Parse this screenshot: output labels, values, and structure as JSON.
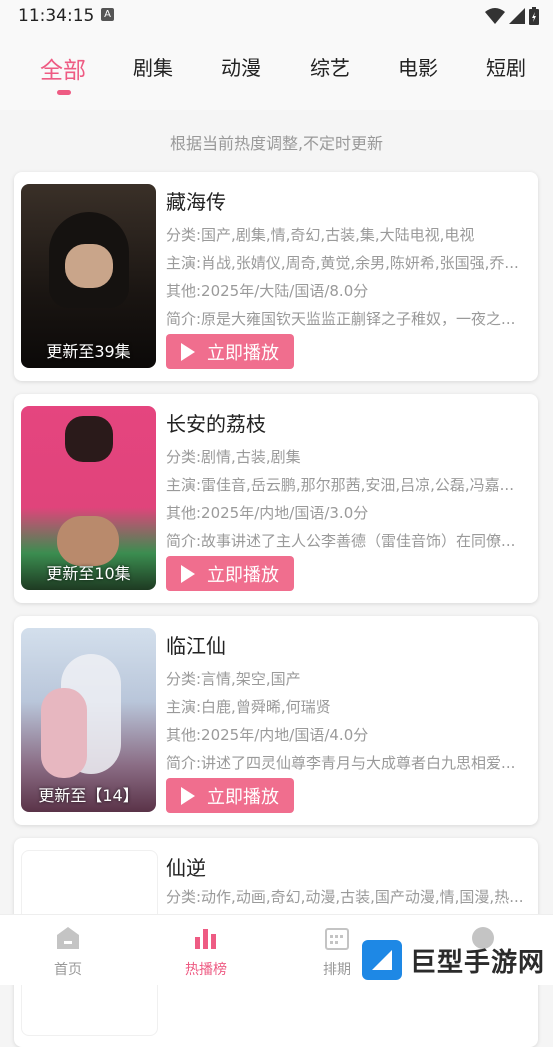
{
  "status": {
    "time": "11:34:15",
    "indicator": "A"
  },
  "tabs": [
    {
      "label": "全部"
    },
    {
      "label": "剧集"
    },
    {
      "label": "动漫"
    },
    {
      "label": "综艺"
    },
    {
      "label": "电影"
    },
    {
      "label": "短剧"
    }
  ],
  "notice": "根据当前热度调整,不定时更新",
  "play_label": "立即播放",
  "items": [
    {
      "title": "藏海传",
      "category": "分类:国产,剧集,情,奇幻,古装,集,大陆电视,电视",
      "cast": "主演:肖战,张婧仪,周奇,黄觉,余男,陈妍希,张国强,乔...",
      "other": "其他:2025年/大陆/国语/8.0分",
      "intro": "简介:原是大雍国钦天监监正蒯铎之子稚奴，一夜之...",
      "badge": "更新至39集",
      "colors": {
        "top": "#2c2620",
        "bottom": "#0d0b0a"
      }
    },
    {
      "title": "长安的荔枝",
      "category": "分类:剧情,古装,剧集",
      "cast": "主演:雷佳音,岳云鹏,那尔那茜,安沺,吕凉,公磊,冯嘉...",
      "other": "其他:2025年/内地/国语/3.0分",
      "intro": "简介:故事讲述了主人公李善德（雷佳音饰）在同僚...",
      "badge": "更新至10集",
      "colors": {
        "top": "#e0447b",
        "bottom": "#3a8a4e"
      }
    },
    {
      "title": "临江仙",
      "category": "分类:言情,架空,国产",
      "cast": "主演:白鹿,曾舜晞,何瑞贤",
      "other": "其他:2025年/内地/国语/4.0分",
      "intro": "简介:讲述了四灵仙尊李青月与大成尊者白九思相爱...",
      "badge": "更新至【14】",
      "colors": {
        "top": "#c6d4e4",
        "bottom": "#7a4a64"
      }
    },
    {
      "title": "仙逆",
      "category": "分类:动作,动画,奇幻,动漫,古装,国产动漫,情,国漫,热...",
      "cast": "",
      "other": "",
      "intro": "",
      "badge": "",
      "colors": {
        "top": "#ffffff",
        "bottom": "#ffffff"
      }
    }
  ],
  "bottom_nav": [
    {
      "label": "首页",
      "icon": "home-icon"
    },
    {
      "label": "热播榜",
      "icon": "bar-chart-icon"
    },
    {
      "label": "排期",
      "icon": "calendar-icon"
    },
    {
      "label": "",
      "icon": "profile-icon"
    }
  ],
  "watermark": "巨型手游网",
  "accent": "#ee5b83"
}
